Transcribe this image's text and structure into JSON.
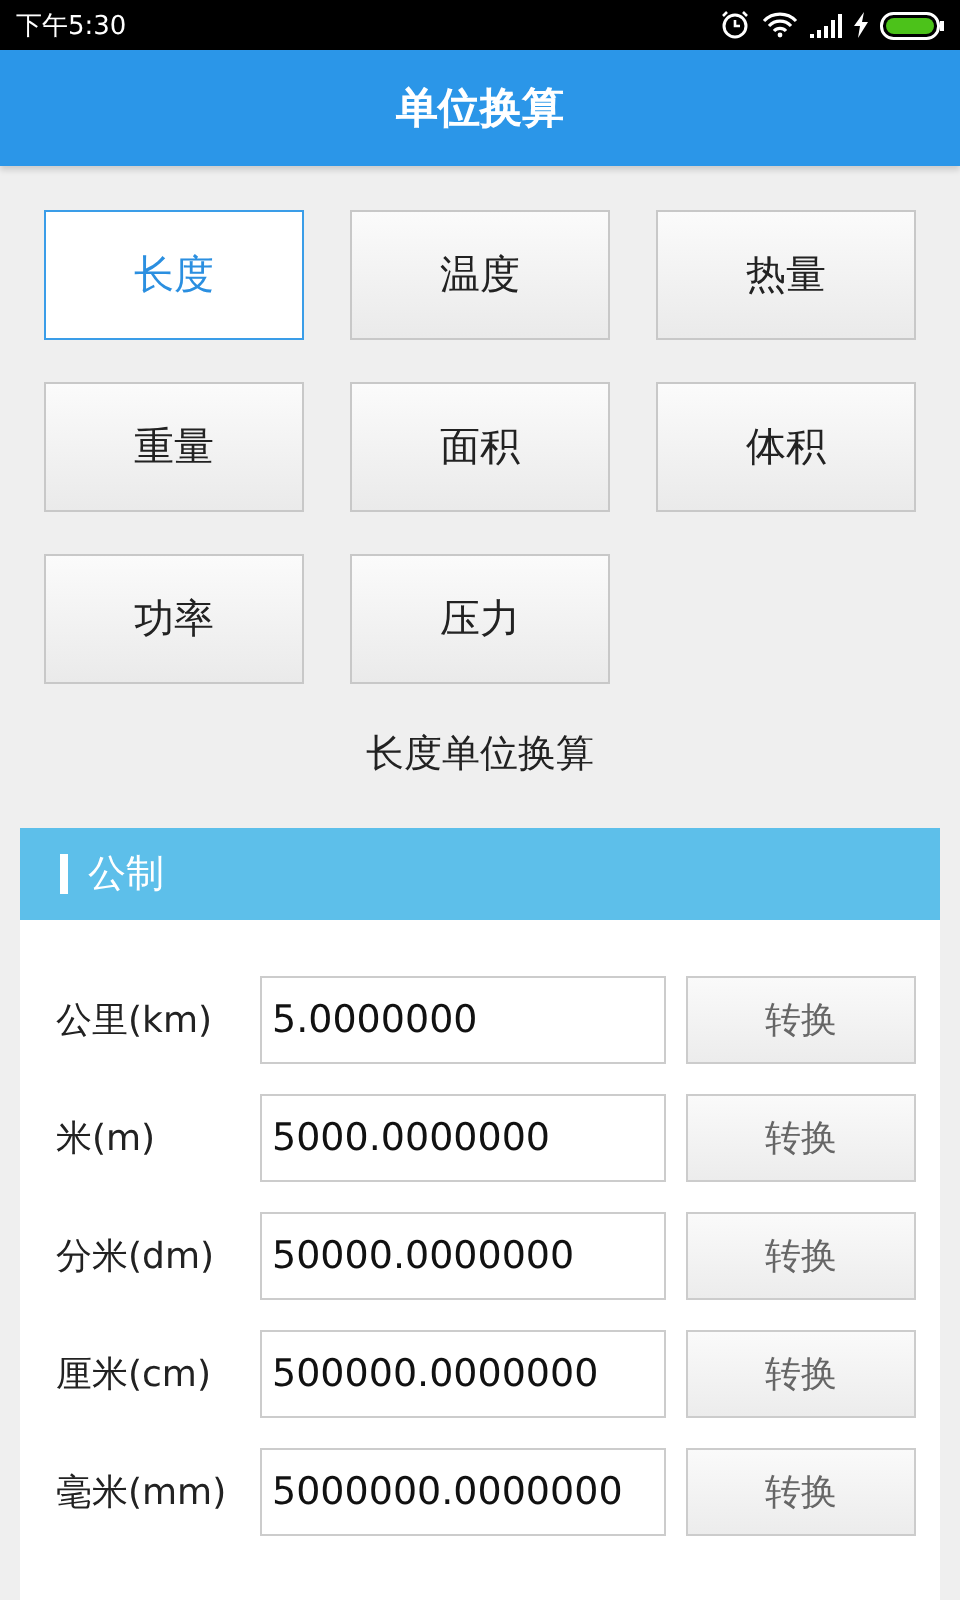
{
  "status_bar": {
    "time": "下午5:30"
  },
  "title": "单位换算",
  "categories": [
    {
      "label": "长度",
      "selected": true
    },
    {
      "label": "温度",
      "selected": false
    },
    {
      "label": "热量",
      "selected": false
    },
    {
      "label": "重量",
      "selected": false
    },
    {
      "label": "面积",
      "selected": false
    },
    {
      "label": "体积",
      "selected": false
    },
    {
      "label": "功率",
      "selected": false
    },
    {
      "label": "压力",
      "selected": false
    }
  ],
  "subtitle": "长度单位换算",
  "section": {
    "title": "公制",
    "rows": [
      {
        "unit": "公里(km)",
        "value": "5.0000000",
        "button": "转换"
      },
      {
        "unit": "米(m)",
        "value": "5000.0000000",
        "button": "转换"
      },
      {
        "unit": "分米(dm)",
        "value": "50000.0000000",
        "button": "转换"
      },
      {
        "unit": "厘米(cm)",
        "value": "500000.0000000",
        "button": "转换"
      },
      {
        "unit": "毫米(mm)",
        "value": "5000000.0000000",
        "button": "转换"
      }
    ]
  }
}
